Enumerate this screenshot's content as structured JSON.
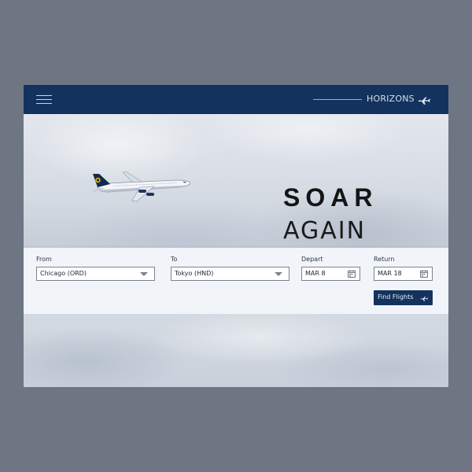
{
  "header": {
    "brand": "HORIZONS",
    "menu_icon": "hamburger-menu-icon",
    "brand_icon": "airplane-icon"
  },
  "hero": {
    "headline_line1": "SOAR",
    "headline_line2": "AGAIN",
    "image": "airplane-in-cloudy-sky"
  },
  "search": {
    "from": {
      "label": "From",
      "value": "Chicago (ORD)"
    },
    "to": {
      "label": "To",
      "value": "Tokyo (HND)"
    },
    "depart": {
      "label": "Depart",
      "value": "MAR 8"
    },
    "return": {
      "label": "Return",
      "value": "MAR 18"
    },
    "submit": {
      "label": "Find Flights",
      "icon": "airplane-icon"
    }
  },
  "colors": {
    "page_background": "#6f7683",
    "header_background": "#14325e",
    "panel_background": "#f1f4f9",
    "button_background": "#14325e"
  }
}
